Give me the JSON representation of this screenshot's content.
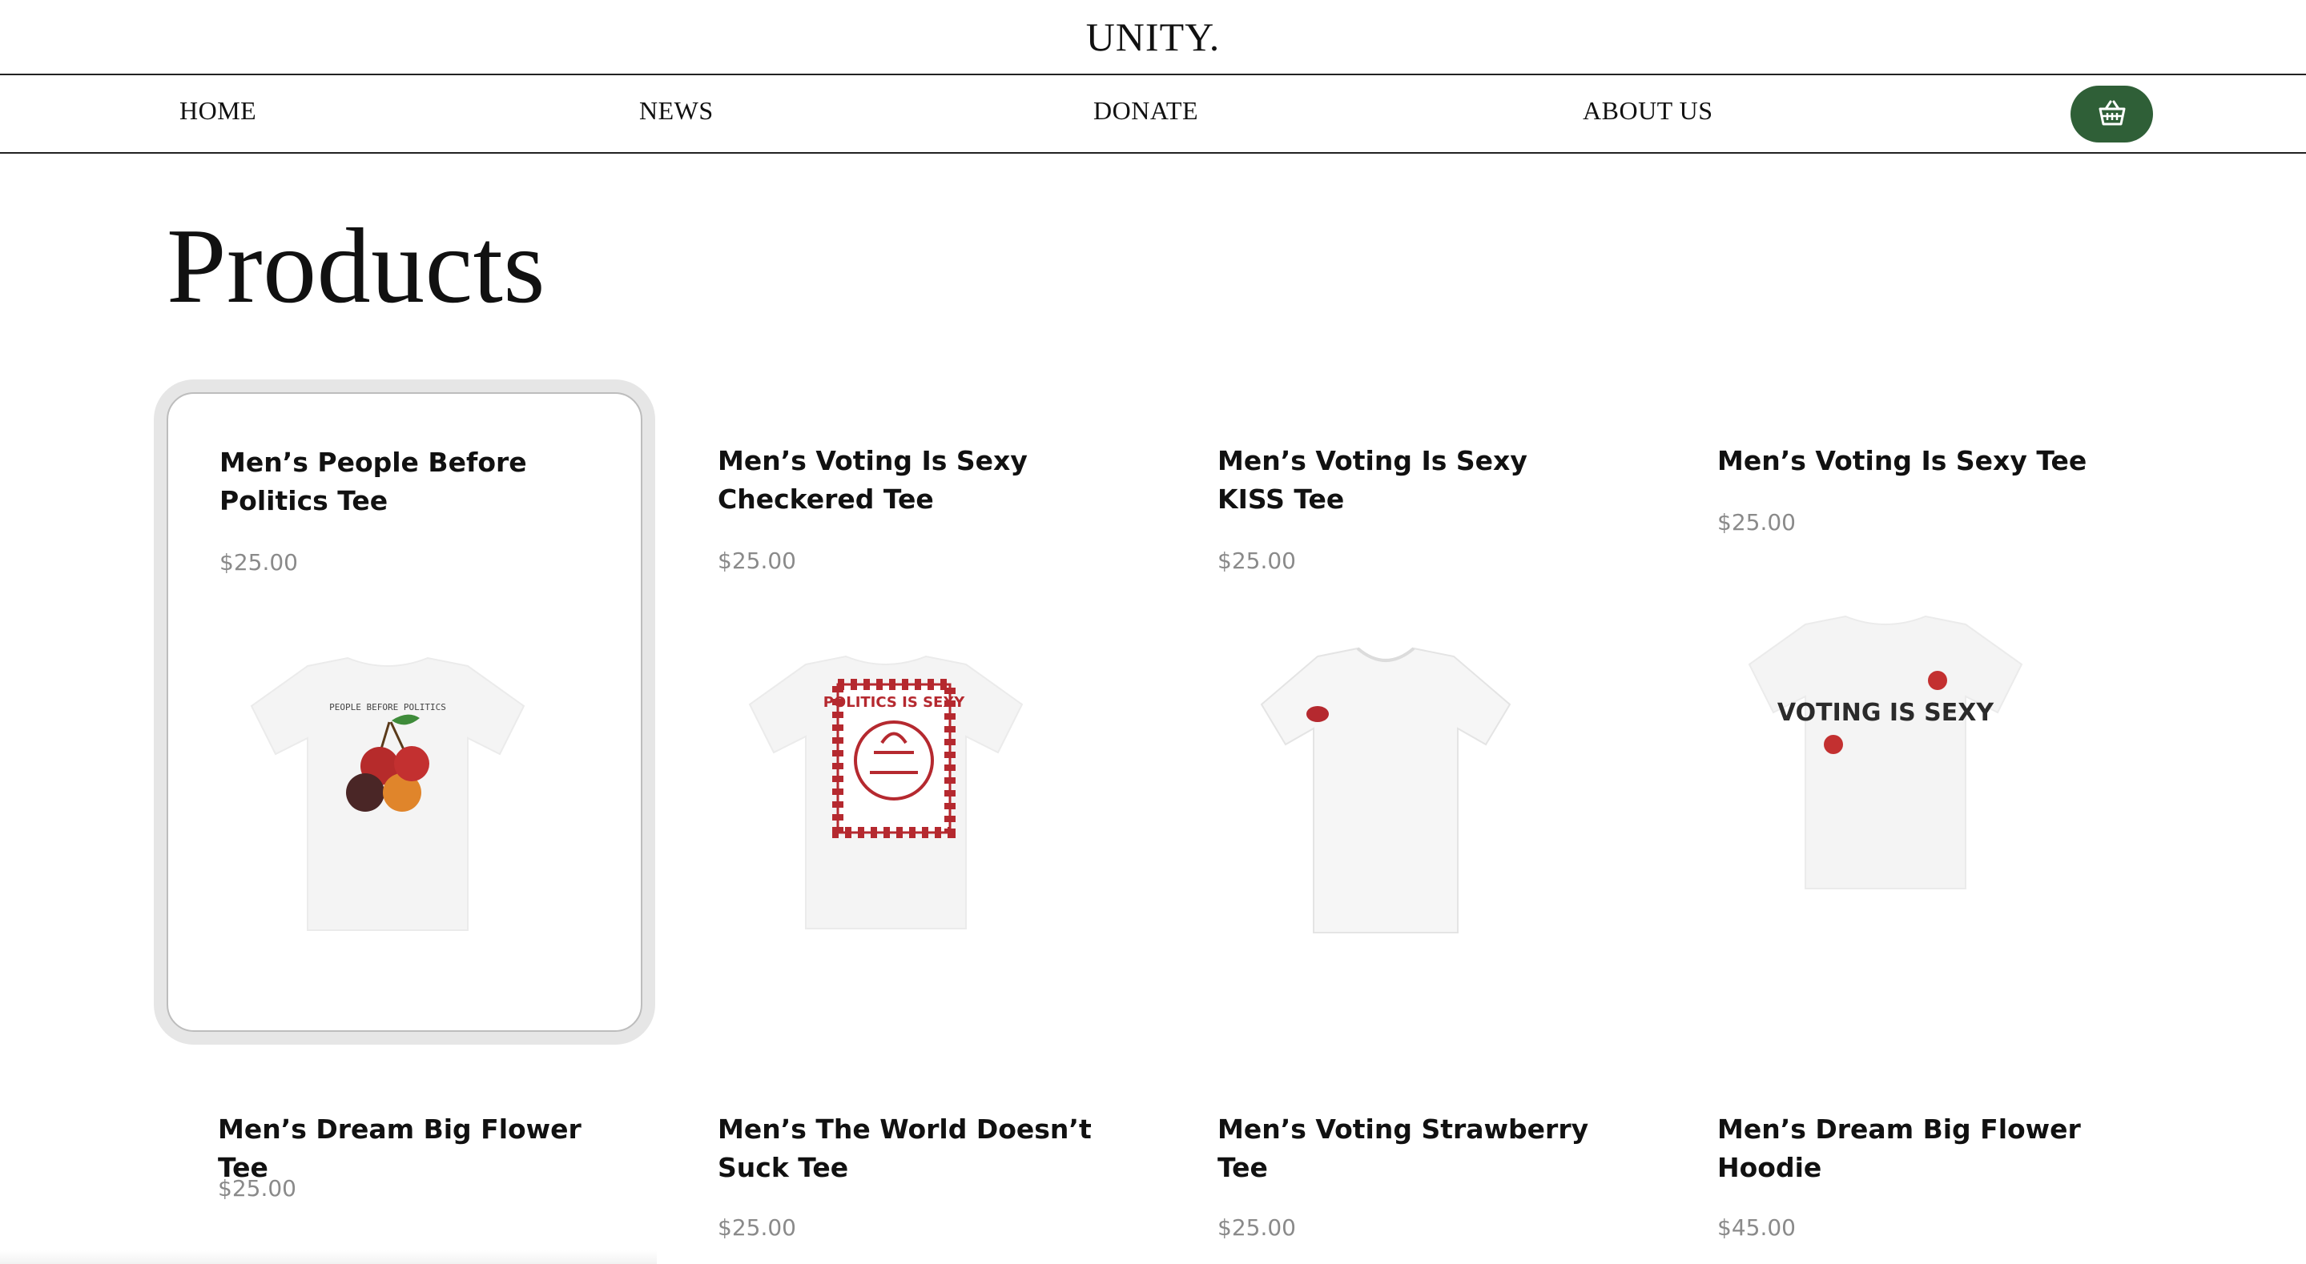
{
  "header": {
    "brand": "UNITY."
  },
  "nav": {
    "items": [
      {
        "label": "HOME"
      },
      {
        "label": "NEWS"
      },
      {
        "label": "DONATE"
      },
      {
        "label": "ABOUT US"
      }
    ],
    "cart_icon": "basket-icon",
    "cart_color": "#2f5f37"
  },
  "page": {
    "title": "Products"
  },
  "products": [
    {
      "title": "Men’s People Before Politics Tee",
      "price": "$25.00",
      "print_text": "PEOPLE BEFORE POLITICS"
    },
    {
      "title": "Men’s Voting Is Sexy Checkered Tee",
      "price": "$25.00",
      "print_text": "POLITICS IS SEXY"
    },
    {
      "title": "Men’s Voting Is Sexy KISS Tee",
      "price": "$25.00"
    },
    {
      "title": "Men’s Voting Is Sexy Tee",
      "price": "$25.00",
      "print_text": "VOTING IS SEXY"
    },
    {
      "title": "Men’s Dream Big Flower Tee",
      "price": "$25.00"
    },
    {
      "title": "Men’s The World Doesn’t Suck Tee",
      "price": "$25.00"
    },
    {
      "title": "Men’s Voting Strawberry Tee",
      "price": "$25.00"
    },
    {
      "title": "Men’s Dream Big Flower Hoodie",
      "price": "$45.00"
    }
  ],
  "colors": {
    "accent": "#2f5f37",
    "price": "#8a8a8a",
    "print_red": "#b5292f"
  }
}
